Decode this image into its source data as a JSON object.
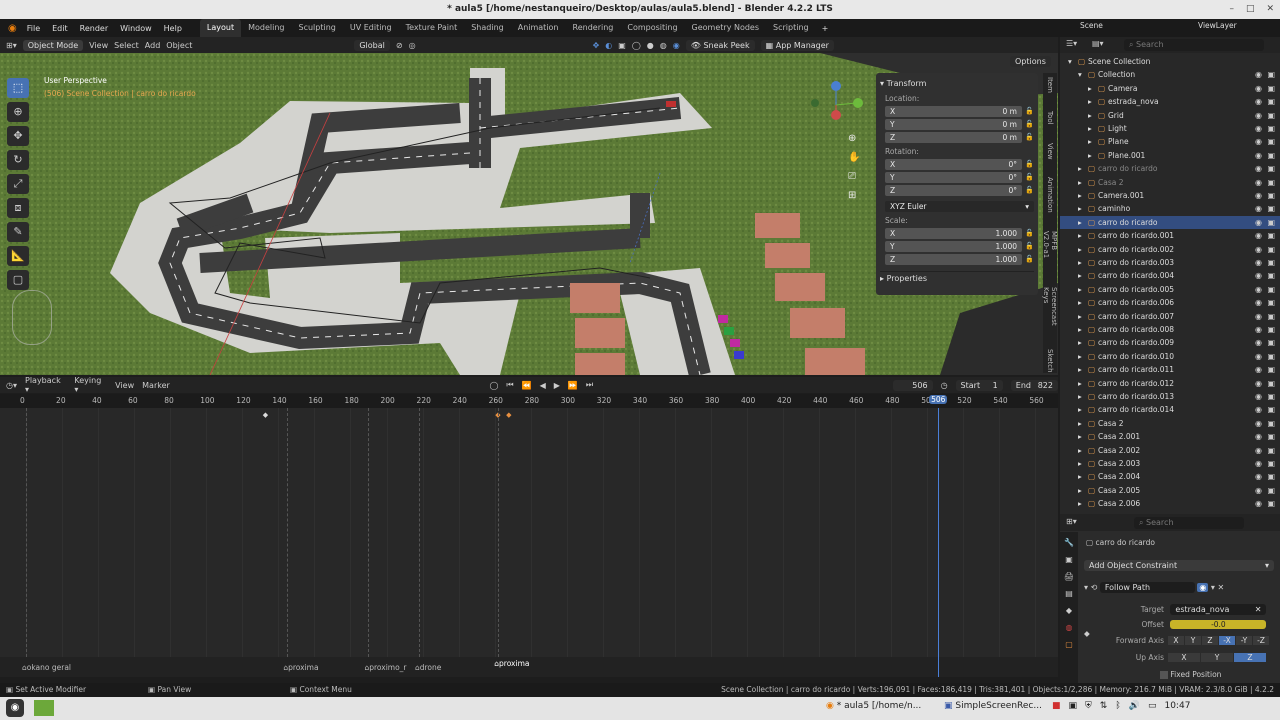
{
  "window": {
    "title": "* aula5 [/home/nestanqueiro/Desktop/aulas/aula5.blend] - Blender 4.2.2 LTS"
  },
  "menu": {
    "items": [
      "File",
      "Edit",
      "Render",
      "Window",
      "Help"
    ]
  },
  "workspaces": [
    "Layout",
    "Modeling",
    "Sculpting",
    "UV Editing",
    "Texture Paint",
    "Shading",
    "Animation",
    "Rendering",
    "Compositing",
    "Geometry Nodes",
    "Scripting"
  ],
  "active_workspace": "Layout",
  "viewport_header": {
    "mode": "Object Mode",
    "view": "View",
    "select": "Select",
    "add": "Add",
    "object": "Object",
    "orientation": "Global",
    "sneak_peek": "Sneak Peek",
    "app_manager": "App Manager",
    "options": "Options"
  },
  "viewport": {
    "perspective": "User Perspective",
    "collection_info": "(506) Scene Collection | carro do ricardo"
  },
  "sidebar_tabs": [
    "Item",
    "Tool",
    "View",
    "Animation",
    "MPFB V2.0-a1",
    "Screencast Keys",
    "Sketch"
  ],
  "transform": {
    "header": "Transform",
    "location_label": "Location:",
    "location": [
      {
        "axis": "X",
        "value": "0 m"
      },
      {
        "axis": "Y",
        "value": "0 m"
      },
      {
        "axis": "Z",
        "value": "0 m"
      }
    ],
    "rotation_label": "Rotation:",
    "rotation": [
      {
        "axis": "X",
        "value": "0°"
      },
      {
        "axis": "Y",
        "value": "0°"
      },
      {
        "axis": "Z",
        "value": "0°"
      }
    ],
    "rotation_mode": "XYZ Euler",
    "scale_label": "Scale:",
    "scale": [
      {
        "axis": "X",
        "value": "1.000"
      },
      {
        "axis": "Y",
        "value": "1.000"
      },
      {
        "axis": "Z",
        "value": "1.000"
      }
    ],
    "properties": "Properties"
  },
  "timeline_header": {
    "playback": "Playback",
    "keying": "Keying",
    "view": "View",
    "marker": "Marker",
    "current_frame": "506",
    "start_label": "Start",
    "start": "1",
    "end_label": "End",
    "end": "822"
  },
  "ruler": {
    "ticks": [
      "0",
      "20",
      "40",
      "60",
      "80",
      "100",
      "120",
      "140",
      "160",
      "180",
      "200",
      "220",
      "240",
      "260",
      "280",
      "300",
      "320",
      "340",
      "360",
      "380",
      "400",
      "420",
      "440",
      "460",
      "480",
      "500",
      "520",
      "540",
      "560"
    ],
    "current": "506"
  },
  "markers": [
    {
      "label": "okano geral",
      "frame": 0
    },
    {
      "label": "proxima",
      "frame": 145
    },
    {
      "label": "proximo_r",
      "frame": 190
    },
    {
      "label": "drone",
      "frame": 218
    },
    {
      "label": "proxima",
      "frame": 262
    }
  ],
  "status": {
    "left1": "Set Active Modifier",
    "left2": "Pan View",
    "left3": "Context Menu",
    "right": "Scene Collection | carro do ricardo | Verts:196,091 | Faces:186,419 | Tris:381,401 | Objects:1/2,286 | Memory: 216.7 MiB | VRAM: 2.3/8.0 GiB | 4.2.2"
  },
  "taskbar": {
    "task1": "* aula5 [/home/n...",
    "task2": "SimpleScreenRec...",
    "clock": "10:47"
  },
  "outliner": {
    "header": {
      "scene": "Scene",
      "view_layer": "ViewLayer",
      "search_placeholder": "Search"
    },
    "items": [
      {
        "name": "Scene Collection",
        "indent": 0,
        "selected": false
      },
      {
        "name": "Collection",
        "indent": 1,
        "selected": false
      },
      {
        "name": "Camera",
        "indent": 2,
        "selected": false
      },
      {
        "name": "estrada_nova",
        "indent": 2,
        "selected": false
      },
      {
        "name": "Grid",
        "indent": 2,
        "selected": false
      },
      {
        "name": "Light",
        "indent": 2,
        "selected": false
      },
      {
        "name": "Plane",
        "indent": 2,
        "selected": false
      },
      {
        "name": "Plane.001",
        "indent": 2,
        "selected": false
      },
      {
        "name": "carro do ricardo",
        "indent": 1,
        "selected": false
      },
      {
        "name": "Casa 2",
        "indent": 1,
        "selected": false
      },
      {
        "name": "Camera.001",
        "indent": 1,
        "selected": false
      },
      {
        "name": "caminho",
        "indent": 1,
        "selected": false
      },
      {
        "name": "carro do ricardo",
        "indent": 1,
        "selected": true
      },
      {
        "name": "carro do ricardo.001",
        "indent": 1,
        "selected": false
      },
      {
        "name": "carro do ricardo.002",
        "indent": 1,
        "selected": false
      },
      {
        "name": "carro do ricardo.003",
        "indent": 1,
        "selected": false
      },
      {
        "name": "carro do ricardo.004",
        "indent": 1,
        "selected": false
      },
      {
        "name": "carro do ricardo.005",
        "indent": 1,
        "selected": false
      },
      {
        "name": "carro do ricardo.006",
        "indent": 1,
        "selected": false
      },
      {
        "name": "carro do ricardo.007",
        "indent": 1,
        "selected": false
      },
      {
        "name": "carro do ricardo.008",
        "indent": 1,
        "selected": false
      },
      {
        "name": "carro do ricardo.009",
        "indent": 1,
        "selected": false
      },
      {
        "name": "carro do ricardo.010",
        "indent": 1,
        "selected": false
      },
      {
        "name": "carro do ricardo.011",
        "indent": 1,
        "selected": false
      },
      {
        "name": "carro do ricardo.012",
        "indent": 1,
        "selected": false
      },
      {
        "name": "carro do ricardo.013",
        "indent": 1,
        "selected": false
      },
      {
        "name": "carro do ricardo.014",
        "indent": 1,
        "selected": false
      },
      {
        "name": "Casa 2",
        "indent": 1,
        "selected": false
      },
      {
        "name": "Casa 2.001",
        "indent": 1,
        "selected": false
      },
      {
        "name": "Casa 2.002",
        "indent": 1,
        "selected": false
      },
      {
        "name": "Casa 2.003",
        "indent": 1,
        "selected": false
      },
      {
        "name": "Casa 2.004",
        "indent": 1,
        "selected": false
      },
      {
        "name": "Casa 2.005",
        "indent": 1,
        "selected": false
      },
      {
        "name": "Casa 2.006",
        "indent": 1,
        "selected": false
      }
    ]
  },
  "properties": {
    "search_placeholder": "Search",
    "object_name": "carro do ricardo",
    "add_constraint": "Add Object Constraint",
    "constraint_name": "Follow Path",
    "target_label": "Target",
    "target": "estrada_nova",
    "offset_label": "Offset",
    "offset_value": "-0.0",
    "forward_label": "Forward Axis",
    "forward_axes": [
      "X",
      "Y",
      "Z",
      "-X",
      "-Y",
      "-Z"
    ],
    "forward_active": "-X",
    "up_label": "Up Axis",
    "up_axes": [
      "X",
      "Y",
      "Z"
    ],
    "up_active": "Z",
    "fixed_position": "Fixed Position"
  }
}
